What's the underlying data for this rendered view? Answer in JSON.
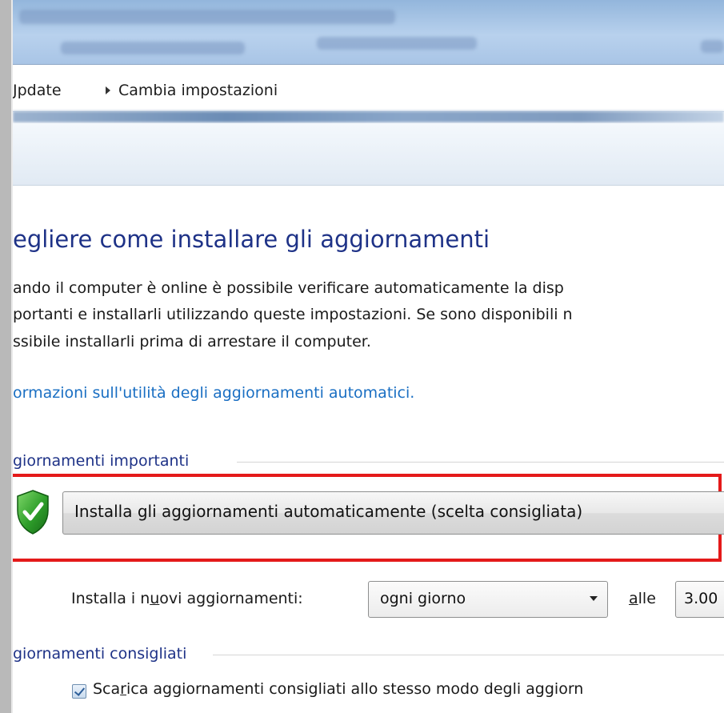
{
  "breadcrumb": {
    "parent": "Jpdate",
    "current": "Cambia impostazioni"
  },
  "main": {
    "title": "egliere come installare gli aggiornamenti",
    "description_lines": [
      "ando il computer è online è possibile verificare automaticamente la disp",
      "portanti e installarli utilizzando queste impostazioni. Se sono disponibili n",
      "ssibile installarli prima di arrestare il computer."
    ],
    "help_link": "ormazioni sull'utilità degli aggiornamenti automatici."
  },
  "important_updates": {
    "group_label": "giornamenti importanti",
    "selected_option": "Installa gli aggiornamenti automaticamente (scelta consigliata)",
    "schedule_label_prefix": "Installa i n",
    "schedule_label_underlined": "u",
    "schedule_label_suffix": "ovi aggiornamenti:",
    "frequency_value": "ogni giorno",
    "time_label_underlined": "a",
    "time_label_rest": "lle",
    "time_value": "3.00"
  },
  "recommended_updates": {
    "group_label": "giornamenti consigliati",
    "checkbox_checked": true,
    "checkbox_label_prefix": "Sca",
    "checkbox_label_underlined": "r",
    "checkbox_label_suffix": "ica aggiornamenti consigliati allo stesso modo degli aggiorn"
  },
  "colors": {
    "heading": "#1e3287",
    "link": "#1a6fc3",
    "highlight_border": "#e41a1a"
  }
}
